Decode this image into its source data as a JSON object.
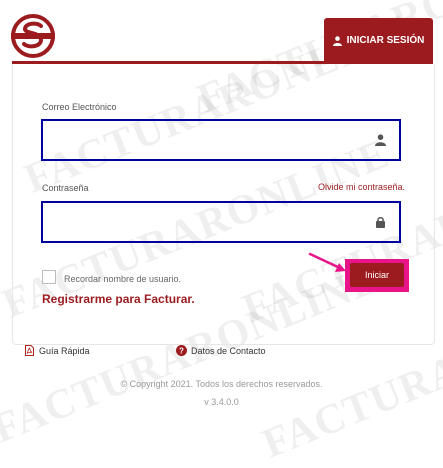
{
  "header": {
    "login_tab_label": "INICIAR SESIÓN"
  },
  "form": {
    "email_label": "Correo Electrónico",
    "email_value": "",
    "password_label": "Contraseña",
    "password_value": "",
    "forgot_password_label": "Olvide mi contraseña.",
    "remember_label": "Recordar nombre de usuario.",
    "remember_checked": false,
    "submit_label": "Iniciar",
    "register_label": "Registrarme para Facturar."
  },
  "footer": {
    "quick_guide_label": "Guía Rápida",
    "contact_label": "Datos de Contacto",
    "copyright": "© Copyright 2021. Todos los derechos reservados.",
    "version": "v 3.4.0.0"
  },
  "watermark_text": "FACTURARONLINE",
  "colors": {
    "brand": "#9b1b1e",
    "field_border": "#00009e",
    "highlight": "#e8158a"
  }
}
